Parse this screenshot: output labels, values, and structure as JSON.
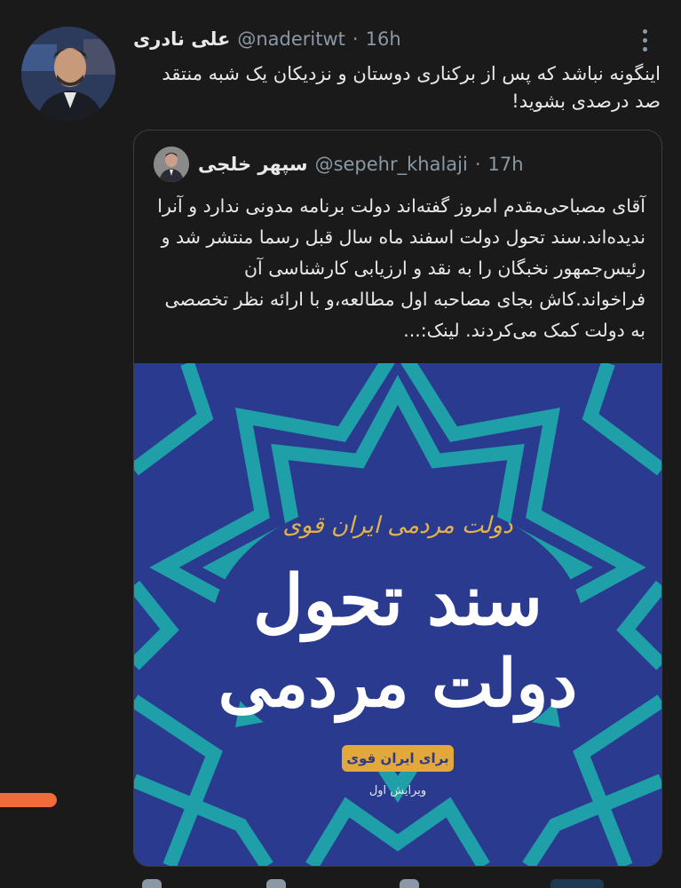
{
  "tweet": {
    "display_name": "علی نادری",
    "handle": "@naderitwt",
    "separator": "·",
    "time": "16h",
    "text": "اینگونه نباشد که پس از برکناری دوستان و نزدیکان یک شبه منتقد صد درصدی بشوید!"
  },
  "quoted": {
    "display_name": "سپهر خلجی",
    "handle": "@sepehr_khalaji",
    "separator": "·",
    "time": "17h",
    "text": "آقای مصباحی‌مقدم امروز گفته‌اند دولت برنامه مدونی ندارد و آنرا ندیده‌اند.سند تحول دولت اسفند ماه سال قبل رسما منتشر شد و رئیس‌جمهور نخبگان را به نقد و ارزیابی کارشناسی آن فراخواند.کاش بجای مصاحبه اول مطالعه،و با ارائه نظر تخصصی به دولت کمک می‌کردند. لینک:...",
    "image": {
      "small_title": "دولت مردمی ایران قوی",
      "title_line1": "سند تحول",
      "title_line2": "دولت مردمی",
      "pill": "برای ایران قوی",
      "edition": "ویرایش اول"
    }
  },
  "icons": {
    "more": "more-options-icon"
  },
  "colors": {
    "background": "#1a1a1a",
    "text": "#e7e9ea",
    "muted": "#8b98a5",
    "book_blue": "#2a3b8f",
    "book_teal": "#1fa0a8",
    "book_gold": "#e2a83c"
  }
}
